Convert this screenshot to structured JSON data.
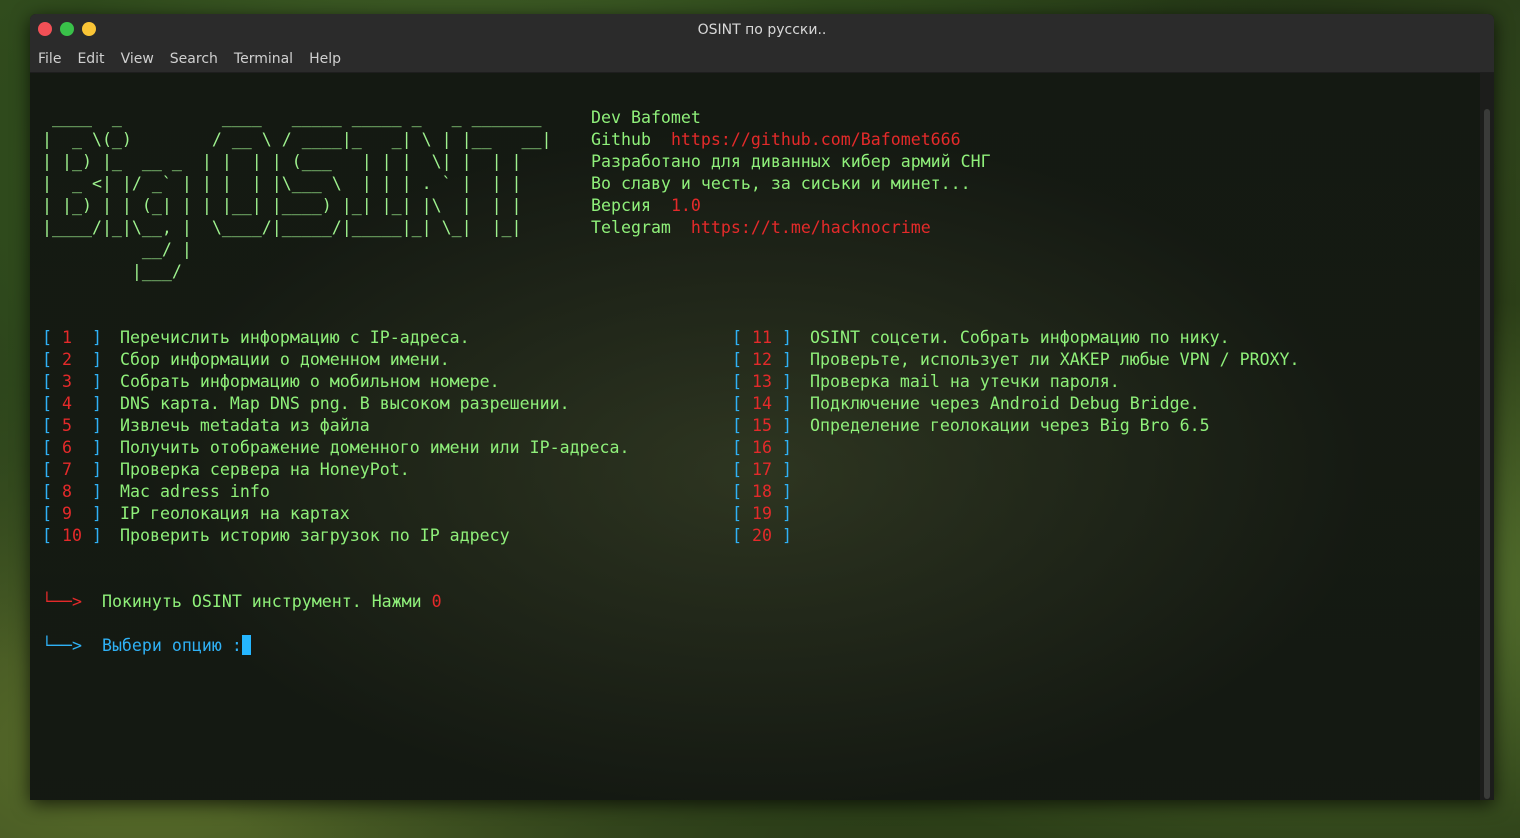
{
  "window": {
    "title": "OSINT по русски..",
    "menu": [
      "File",
      "Edit",
      "View",
      "Search",
      "Terminal",
      "Help"
    ]
  },
  "banner": {
    "ascii": " ____  _          ____   _____ _____ _   _ _______\n|  _ \\(_)        / __ \\ / ____|_   _| \\ | |__   __|\n| |_) |_  __ _  | |  | | (___   | | |  \\| |  | |\n|  _ <| |/ _` | | |  | |\\___ \\  | | | . ` |  | |\n| |_) | | (_| | | |__| |____) |_| |_| |\\  |  | |\n|____/|_|\\__, |  \\____/|_____/|_____|_| \\_|  |_|\n          __/ |\n         |___/",
    "dev_label": "Dev Bafomet",
    "github_label": "Github",
    "github_url": "https://github.com/Bafomet666",
    "line_dev": "Разработано для диванных кибер армий СНГ",
    "line_slogan": "Во славу и честь, за сиськи и минет...",
    "version_label": "Версия",
    "version_value": "1.0",
    "telegram_label": "Telegram",
    "telegram_url": "https://t.me/hacknocrime"
  },
  "menu_left": [
    {
      "num": "1",
      "text": "Перечислить информацию с IP-адреса."
    },
    {
      "num": "2",
      "text": "Сбор информации о доменном имени."
    },
    {
      "num": "3",
      "text": "Собрать информацию о мобильном номере."
    },
    {
      "num": "4",
      "text": "DNS карта. Map DNS png. В высоком разрешении."
    },
    {
      "num": "5",
      "text": "Извлечь metadata из файла"
    },
    {
      "num": "6",
      "text": "Получить отображение доменного имени или IP-адреса."
    },
    {
      "num": "7",
      "text": "Проверка сервера на HoneyPot."
    },
    {
      "num": "8",
      "text": "Mac adress info"
    },
    {
      "num": "9",
      "text": "IP геолокация на картах"
    },
    {
      "num": "10",
      "text": "Проверить историю загрузок по IP адресу"
    }
  ],
  "menu_right": [
    {
      "num": "11",
      "text": "OSINT соцсети. Собрать информацию по нику."
    },
    {
      "num": "12",
      "text": "Проверьте, использует ли ХАКЕР любые VPN / PROXY."
    },
    {
      "num": "13",
      "text": "Проверка mail на утечки пароля."
    },
    {
      "num": "14",
      "text": "Подключение через Android Debug Bridge."
    },
    {
      "num": "15",
      "text": "Определение геолокации через Big Bro 6.5"
    },
    {
      "num": "16",
      "text": ""
    },
    {
      "num": "17",
      "text": ""
    },
    {
      "num": "18",
      "text": ""
    },
    {
      "num": "19",
      "text": ""
    },
    {
      "num": "20",
      "text": ""
    }
  ],
  "exit": {
    "arrow": "└──>",
    "text": "Покинуть OSINT инструмент. Нажми",
    "key": "0"
  },
  "prompt": {
    "arrow": "└──>",
    "text": "Выбери опцию :"
  },
  "colors": {
    "green": "#8ff07a",
    "red": "#e42a2a",
    "cyan": "#2fb1f5"
  }
}
